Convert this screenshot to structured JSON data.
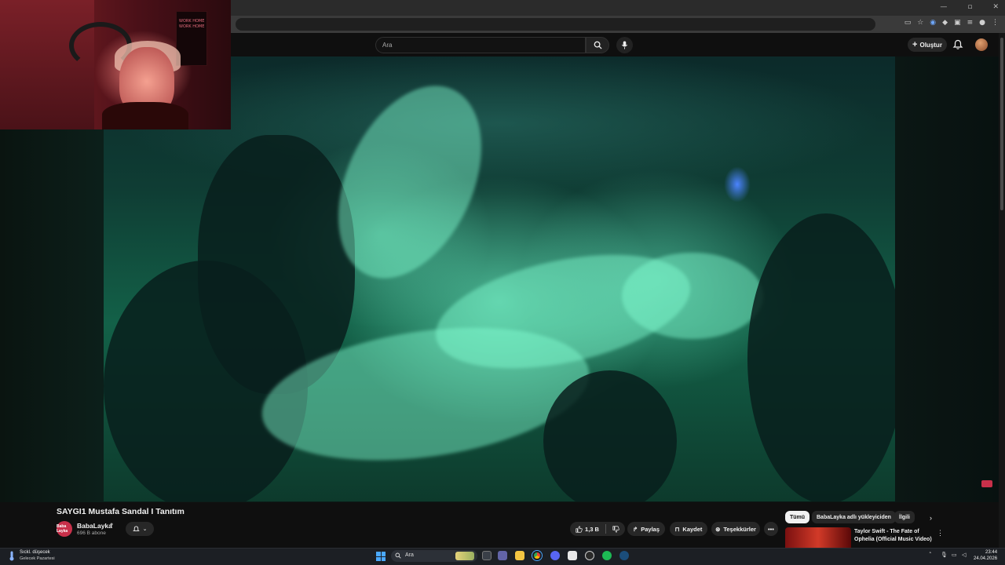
{
  "browser": {
    "window_controls": [
      "—",
      "▫",
      "✕"
    ],
    "toolbar_icons": [
      "cast-icon",
      "star-icon",
      "extension-icon",
      "diamond-icon",
      "puzzle-icon",
      "sidebar-icon",
      "profile-icon",
      "menu-icon"
    ]
  },
  "header": {
    "search_placeholder": "Ara",
    "create_label": "Oluştur"
  },
  "webcam": {
    "poster_text": "WORK HOME WORK HOME"
  },
  "video": {
    "title": "SAYGI1 Mustafa Sandal I Tanıtım"
  },
  "channel": {
    "name": "BabaLayka",
    "logo_text": "Baba Layka",
    "subscribers": "696 B abone"
  },
  "actions": {
    "like_count": "1,3 B",
    "share_label": "Paylaş",
    "save_label": "Kaydet",
    "thanks_label": "Teşekkürler"
  },
  "recommendations": {
    "chips": [
      "Tümü",
      "BabaLayka adlı yükleyiciden",
      "İlgili"
    ],
    "items": [
      {
        "title": "Taylor Swift - The Fate of Ophelia (Official Music Video)"
      }
    ]
  },
  "taskbar": {
    "weather_line1": "Sıckl. düşecek",
    "weather_line2": "Gelecek Pazartesi",
    "search_label": "Ara",
    "time": "23:44",
    "date": "24.04.2026"
  },
  "colors": {
    "accent_red": "#c8304a",
    "video_tint": "#136148",
    "windows_blue": "#4aa8ff"
  }
}
